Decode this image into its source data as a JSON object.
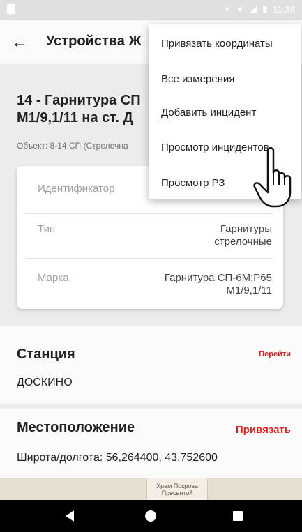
{
  "status_bar": {
    "time": "11:36"
  },
  "appbar": {
    "title": "Устройства Ж"
  },
  "object": {
    "title": "14 - Гарнитура СП М1/9,1/11 на ст. Д",
    "subtitle": "Объект: 8-14 СП (Стрелочна"
  },
  "details": [
    {
      "key": "Идентификатор",
      "value": ""
    },
    {
      "key": "Тип",
      "value": "Гарнитуры стрелочные"
    },
    {
      "key": "Марка",
      "value": "Гарнитура СП-6М;Р65 М1/9,1/11"
    }
  ],
  "station": {
    "title": "Станция",
    "link": "Перейти",
    "value": "ДОСКИНО"
  },
  "location": {
    "title": "Местоположение",
    "link": "Привязать",
    "value": "Широта/долгота: 56,264400, 43,752600"
  },
  "map": {
    "label": "Храм Покрова Пресвятой"
  },
  "menu": {
    "items": [
      "Привязать координаты",
      "Все измерения",
      "Добавить инцидент",
      "Просмотр инцидентов",
      "Просмотр РЗ"
    ]
  }
}
